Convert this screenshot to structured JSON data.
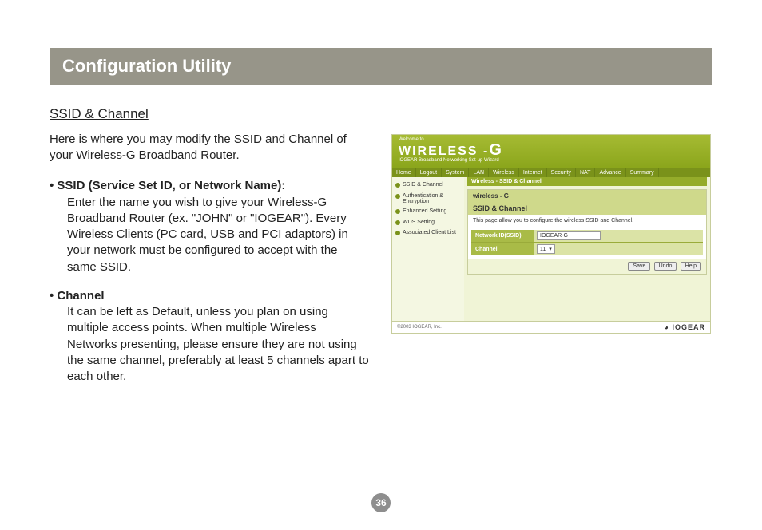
{
  "page_number": "36",
  "title_bar": "Configuration Utility",
  "section_heading": "SSID & Channel",
  "intro": "Here is where you may modify the SSID and Channel of your Wireless-G Broadband Router.",
  "bullets": [
    {
      "head": "• SSID (Service Set ID, or Network Name):",
      "body": "Enter the name you wish to give your Wireless-G Broadband Router (ex. \"JOHN\" or \"IOGEAR\"). Every Wireless Clients (PC card, USB and PCI adaptors) in your network must be configured to accept with the same SSID."
    },
    {
      "head": "• Channel",
      "body": "It can be left as Default, unless you plan on using multiple access points. When multiple Wireless Networks presenting, please ensure they are not using the same channel, preferably at least 5 channels apart to each other."
    }
  ],
  "screenshot": {
    "welcome": "Welcome to",
    "logo_main": "WIRELESS -",
    "logo_g": "G",
    "sub": "IOGEAR Broadband Networking Set-up Wizard",
    "tabs": [
      "Home",
      "Logout",
      "System",
      "LAN",
      "Wireless",
      "Internet",
      "Security",
      "NAT",
      "Advance",
      "Summary"
    ],
    "sidebar": [
      "SSID & Channel",
      "Authentication & Encryption",
      "Enhanced Setting",
      "WDS Setting",
      "Associated Client List"
    ],
    "crumb": "Wireless - SSID & Channel",
    "card_logo": "wireless - G",
    "card_title": "SSID & Channel",
    "card_desc": "This page allow you to configure the wireless SSID and Channel.",
    "form": {
      "ssid_label": "Network ID(SSID)",
      "ssid_value": "IOGEAR-G",
      "channel_label": "Channel",
      "channel_value": "11"
    },
    "buttons": [
      "Save",
      "Undo",
      "Help"
    ],
    "footer_left": "©2003 IOGEAR, Inc.",
    "footer_brand": "IOGEAR"
  }
}
